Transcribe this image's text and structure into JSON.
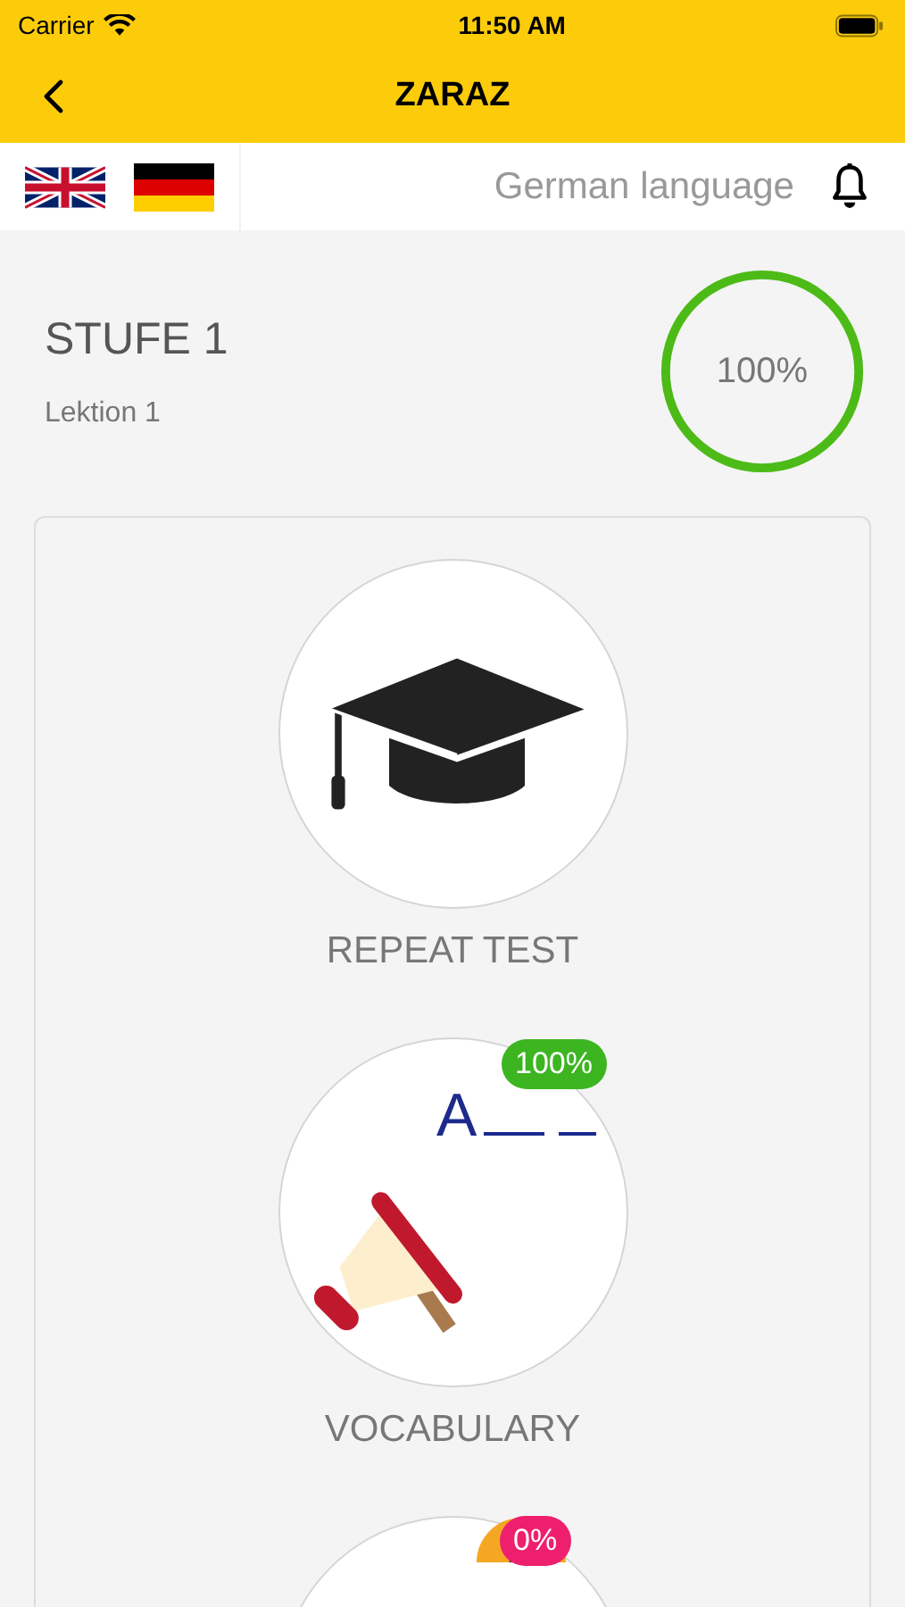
{
  "status_bar": {
    "carrier": "Carrier",
    "time": "11:50 AM"
  },
  "nav": {
    "title": "ZARAZ"
  },
  "language_bar": {
    "label": "German language"
  },
  "level": {
    "title": "STUFE 1",
    "subtitle": "Lektion 1",
    "progress": {
      "text": "100%",
      "level": 1
    }
  },
  "activities": [
    {
      "kind": "test",
      "label": "REPEAT TEST"
    },
    {
      "kind": "vocabulary",
      "label": "VOCABULARY",
      "letter": "A",
      "badge": {
        "text": "100%",
        "color": "#3cb521"
      }
    },
    {
      "kind": "listening",
      "badge": {
        "text": "0%",
        "color": "#ee1f6e"
      }
    }
  ]
}
